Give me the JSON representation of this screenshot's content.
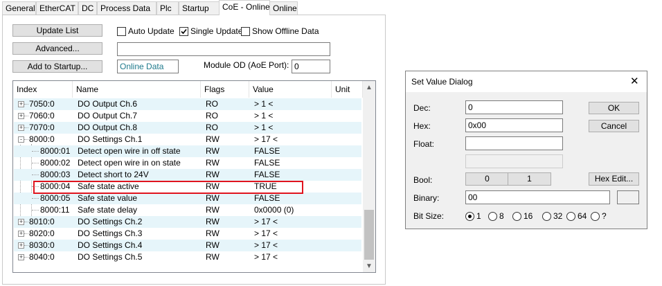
{
  "tabs": [
    "General",
    "EtherCAT",
    "DC",
    "Process Data",
    "Plc",
    "Startup",
    "CoE - Online",
    "Online"
  ],
  "active_tab": "CoE - Online",
  "buttons": {
    "update_list": "Update List",
    "advanced": "Advanced...",
    "add_to_startup": "Add to Startup..."
  },
  "checkboxes": {
    "auto_update": {
      "label": "Auto Update",
      "checked": false
    },
    "single_update": {
      "label": "Single Update",
      "checked": true
    },
    "show_offline": {
      "label": "Show Offline Data",
      "checked": false
    }
  },
  "advanced_field": "",
  "data_source": "Online Data",
  "module_od_label": "Module OD (AoE Port):",
  "module_od_value": "0",
  "table": {
    "headers": [
      "Index",
      "Name",
      "Flags",
      "Value",
      "Unit"
    ],
    "rows": [
      {
        "index": "7050:0",
        "name": "DO Output Ch.6",
        "flags": "RO",
        "value": "> 1 <",
        "expander": "+"
      },
      {
        "index": "7060:0",
        "name": "DO Output Ch.7",
        "flags": "RO",
        "value": "> 1 <",
        "expander": "+"
      },
      {
        "index": "7070:0",
        "name": "DO Output Ch.8",
        "flags": "RO",
        "value": "> 1 <",
        "expander": "+"
      },
      {
        "index": "8000:0",
        "name": "DO Settings Ch.1",
        "flags": "RW",
        "value": "> 17 <",
        "expander": "-"
      },
      {
        "index": "8000:01",
        "name": "Detect open wire in off state",
        "flags": "RW",
        "value": "FALSE",
        "expander": ""
      },
      {
        "index": "8000:02",
        "name": "Detect open wire in on state",
        "flags": "RW",
        "value": "FALSE",
        "expander": ""
      },
      {
        "index": "8000:03",
        "name": "Detect short to 24V",
        "flags": "RW",
        "value": "FALSE",
        "expander": ""
      },
      {
        "index": "8000:04",
        "name": "Safe state active",
        "flags": "RW",
        "value": "TRUE",
        "expander": ""
      },
      {
        "index": "8000:05",
        "name": "Safe state value",
        "flags": "RW",
        "value": "FALSE",
        "expander": ""
      },
      {
        "index": "8000:11",
        "name": "Safe state delay",
        "flags": "RW",
        "value": "0x0000 (0)",
        "expander": ""
      },
      {
        "index": "8010:0",
        "name": "DO Settings Ch.2",
        "flags": "RW",
        "value": "> 17 <",
        "expander": "+"
      },
      {
        "index": "8020:0",
        "name": "DO Settings Ch.3",
        "flags": "RW",
        "value": "> 17 <",
        "expander": "+"
      },
      {
        "index": "8030:0",
        "name": "DO Settings Ch.4",
        "flags": "RW",
        "value": "> 17 <",
        "expander": "+"
      },
      {
        "index": "8040:0",
        "name": "DO Settings Ch.5",
        "flags": "RW",
        "value": "> 17 <",
        "expander": "+"
      }
    ]
  },
  "dialog": {
    "title": "Set Value Dialog",
    "close": "✕",
    "dec_label": "Dec:",
    "dec_value": "0",
    "hex_label": "Hex:",
    "hex_value": "0x00",
    "float_label": "Float:",
    "float_value": "",
    "bool_label": "Bool:",
    "bool_0": "0",
    "bool_1": "1",
    "binary_label": "Binary:",
    "binary_value": "00",
    "bitsize_label": "Bit Size:",
    "bit_sizes": [
      "1",
      "8",
      "16",
      "32",
      "64",
      "?"
    ],
    "bit_size_selected": "1",
    "ok": "OK",
    "cancel": "Cancel",
    "hex_edit": "Hex Edit..."
  },
  "colors": {
    "highlight": "#e0141e",
    "alt_row": "#e6f5fa",
    "data_source_text": "#1e7a8c"
  }
}
